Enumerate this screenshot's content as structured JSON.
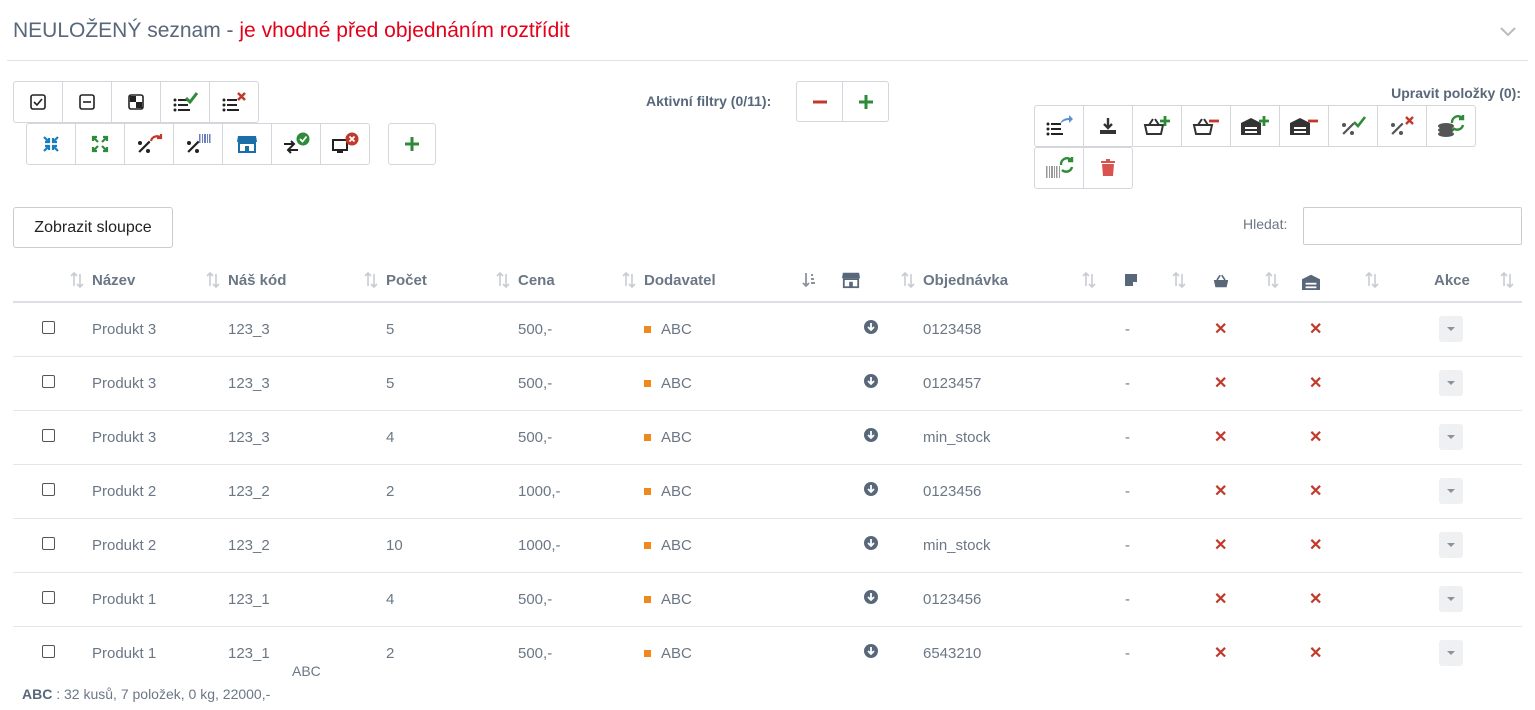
{
  "header": {
    "title_main": "NEULOŽENÝ seznam - ",
    "title_warning": "je vhodné před objednáním roztřídit"
  },
  "toolbar": {
    "filters_label": "Aktivní filtry (0/11):",
    "edit_label": "Upravit položky (0):",
    "show_columns": "Zobrazit sloupce",
    "search_label": "Hledat:",
    "search_value": ""
  },
  "colors": {
    "accent_green": "#2e8b3a",
    "accent_red": "#c0392b",
    "accent_blue": "#1a7fc1",
    "supplier_orange": "#f0891c",
    "text_muted": "#6b7785"
  },
  "table": {
    "columns": [
      "Název",
      "Náš kód",
      "Počet",
      "Cena",
      "Dodavatel",
      "Objednávka",
      "Akce"
    ],
    "rows": [
      {
        "name": "Produkt 3",
        "code": "123_3",
        "count": "5",
        "price": "500,-",
        "supplier": "ABC",
        "order": "0123458",
        "note": "-"
      },
      {
        "name": "Produkt 3",
        "code": "123_3",
        "count": "5",
        "price": "500,-",
        "supplier": "ABC",
        "order": "0123457",
        "note": "-"
      },
      {
        "name": "Produkt 3",
        "code": "123_3",
        "count": "4",
        "price": "500,-",
        "supplier": "ABC",
        "order": "min_stock",
        "note": "-"
      },
      {
        "name": "Produkt 2",
        "code": "123_2",
        "count": "2",
        "price": "1000,-",
        "supplier": "ABC",
        "order": "0123456",
        "note": "-"
      },
      {
        "name": "Produkt 2",
        "code": "123_2",
        "count": "10",
        "price": "1000,-",
        "supplier": "ABC",
        "order": "min_stock",
        "note": "-"
      },
      {
        "name": "Produkt 1",
        "code": "123_1",
        "count": "4",
        "price": "500,-",
        "supplier": "ABC",
        "order": "0123456",
        "note": "-"
      },
      {
        "name": "Produkt 1",
        "code": "123_1",
        "count": "2",
        "price": "500,-",
        "supplier": "ABC",
        "order": "6543210",
        "note": "-"
      }
    ],
    "group_label": "ABC"
  },
  "footer": {
    "supplier": "ABC",
    "summary": " : 32 kusů, 7 položek, 0 kg, 22000,-"
  }
}
